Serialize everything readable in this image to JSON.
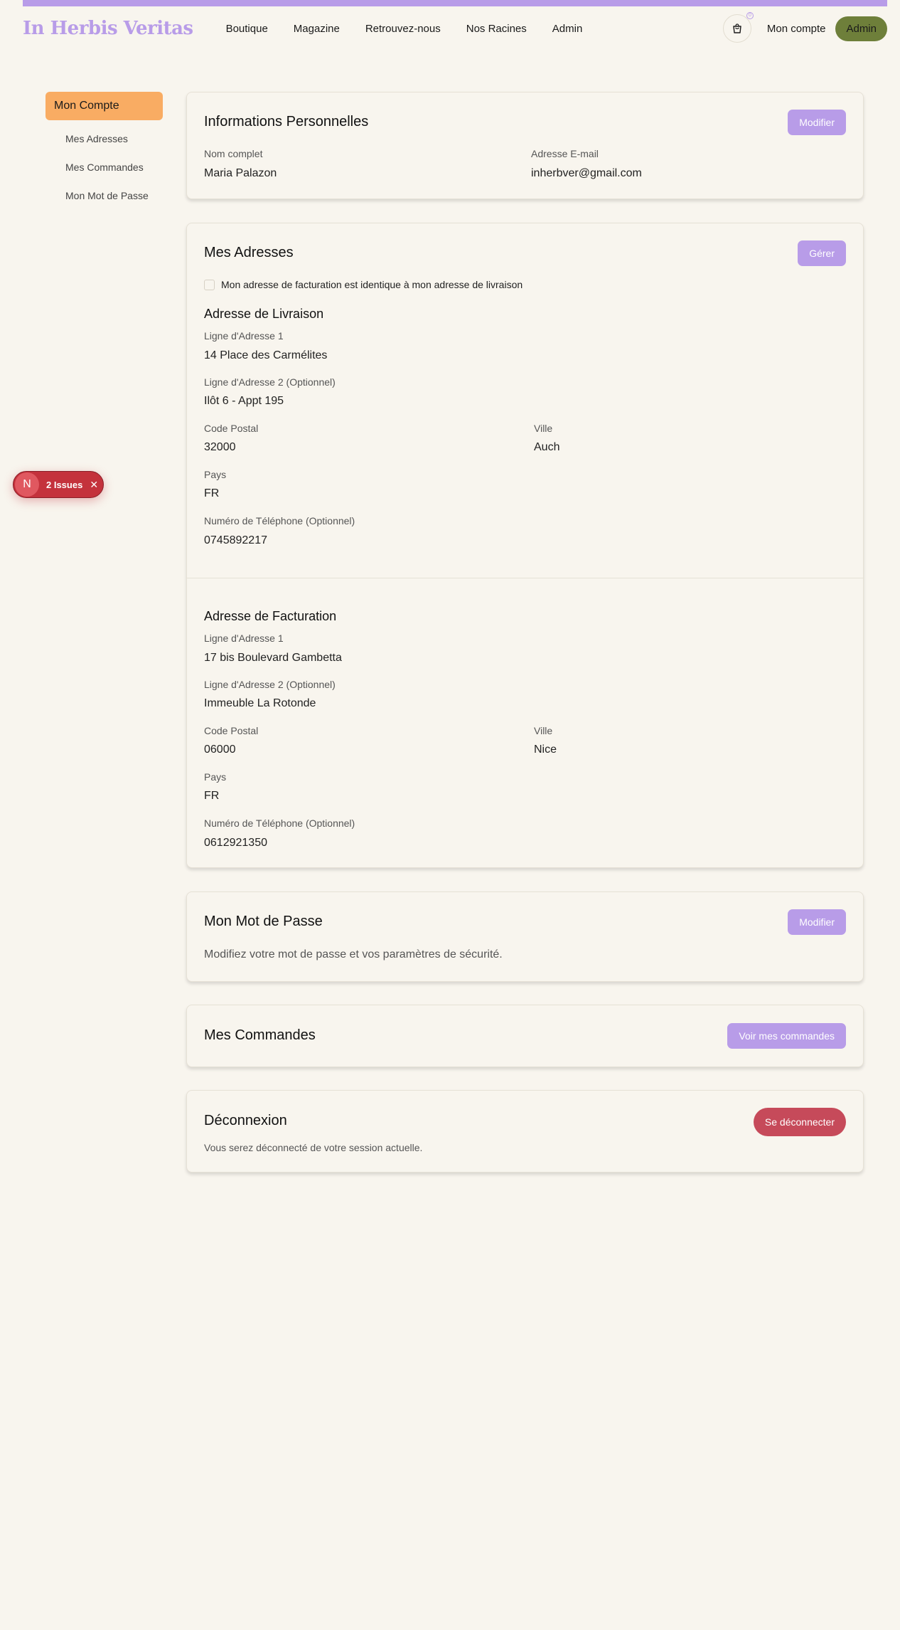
{
  "header": {
    "logo": "In Herbis Veritas",
    "nav": [
      "Boutique",
      "Magazine",
      "Retrouvez-nous",
      "Nos Racines",
      "Admin"
    ],
    "cart_count": "0",
    "account_link": "Mon compte",
    "admin_button": "Admin"
  },
  "sidebar": {
    "active": "Mon Compte",
    "items": [
      "Mes Adresses",
      "Mes Commandes",
      "Mon Mot de Passe"
    ]
  },
  "personal": {
    "title": "Informations Personnelles",
    "button": "Modifier",
    "name_label": "Nom complet",
    "name_value": "Maria Palazon",
    "email_label": "Adresse E-mail",
    "email_value": "inherbver@gmail.com"
  },
  "addresses": {
    "title": "Mes Adresses",
    "button": "Gérer",
    "same_billing_label": "Mon adresse de facturation est identique à mon adresse de livraison",
    "shipping": {
      "title": "Adresse de Livraison",
      "line1_label": "Ligne d'Adresse 1",
      "line1": "14 Place des Carmélites",
      "line2_label": "Ligne d'Adresse 2 (Optionnel)",
      "line2": "Ilôt 6 - Appt 195",
      "postal_label": "Code Postal",
      "postal": "32000",
      "city_label": "Ville",
      "city": "Auch",
      "country_label": "Pays",
      "country": "FR",
      "phone_label": "Numéro de Téléphone (Optionnel)",
      "phone": "0745892217"
    },
    "billing": {
      "title": "Adresse de Facturation",
      "line1_label": "Ligne d'Adresse 1",
      "line1": "17 bis Boulevard Gambetta",
      "line2_label": "Ligne d'Adresse 2 (Optionnel)",
      "line2": "Immeuble La Rotonde",
      "postal_label": "Code Postal",
      "postal": "06000",
      "city_label": "Ville",
      "city": "Nice",
      "country_label": "Pays",
      "country": "FR",
      "phone_label": "Numéro de Téléphone (Optionnel)",
      "phone": "0612921350"
    }
  },
  "password": {
    "title": "Mon Mot de Passe",
    "button": "Modifier",
    "description": "Modifiez votre mot de passe et vos paramètres de sécurité."
  },
  "orders": {
    "title": "Mes Commandes",
    "button": "Voir mes commandes"
  },
  "logout": {
    "title": "Déconnexion",
    "button": "Se déconnecter",
    "description": "Vous serez déconnecté de votre session actuelle."
  },
  "issues_badge": {
    "avatar": "N",
    "label": "2 Issues",
    "close": "✕"
  },
  "colors": {
    "accent": "#b89ce8",
    "sidebar_active": "#f9ac63",
    "admin_button": "#6e7f3a",
    "logout_button": "#c64a5a",
    "issues_badge": "#c4323c",
    "background": "#f8f5ee"
  }
}
